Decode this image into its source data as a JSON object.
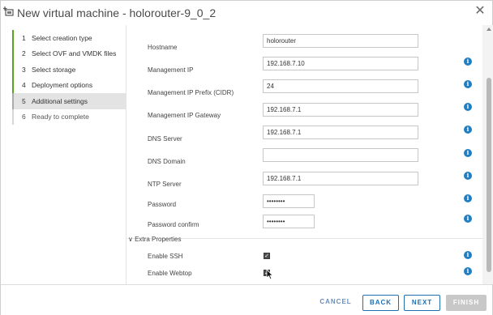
{
  "window": {
    "title": "New virtual machine - holorouter-9_0_2",
    "close_symbol": "✕"
  },
  "steps": [
    {
      "num": "1",
      "label": "Select creation type"
    },
    {
      "num": "2",
      "label": "Select OVF and VMDK files"
    },
    {
      "num": "3",
      "label": "Select storage"
    },
    {
      "num": "4",
      "label": "Deployment options"
    },
    {
      "num": "5",
      "label": "Additional settings"
    },
    {
      "num": "6",
      "label": "Ready to complete"
    }
  ],
  "form": {
    "hostname": {
      "label": "Hostname",
      "value": "holorouter"
    },
    "management_ip": {
      "label": "Management IP",
      "value": "192.168.7.10"
    },
    "management_prefix": {
      "label": "Management IP Prefix (CIDR)",
      "value": "24"
    },
    "management_gateway": {
      "label": "Management IP Gateway",
      "value": "192.168.7.1"
    },
    "dns_server": {
      "label": "DNS Server",
      "value": "192.168.7.1"
    },
    "dns_domain": {
      "label": "DNS Domain",
      "value": ""
    },
    "ntp_server": {
      "label": "NTP Server",
      "value": "192.168.7.1"
    },
    "password": {
      "label": "Password",
      "value": "••••••••"
    },
    "password_confirm": {
      "label": "Password confirm",
      "value": "••••••••"
    },
    "extra_properties": {
      "label": "Extra Properties",
      "chevron": "∨"
    },
    "enable_ssh": {
      "label": "Enable SSH",
      "checked": true,
      "mark": "✓"
    },
    "enable_webtop": {
      "label": "Enable Webtop",
      "checked": true,
      "mark": "✓"
    },
    "info_symbol": "i"
  },
  "footer": {
    "cancel": "CANCEL",
    "back": "BACK",
    "next": "NEXT",
    "finish": "FINISH"
  },
  "colors": {
    "completed_step": "#5aa220",
    "info": "#1f7fc2",
    "primary": "#1f6fb2"
  }
}
